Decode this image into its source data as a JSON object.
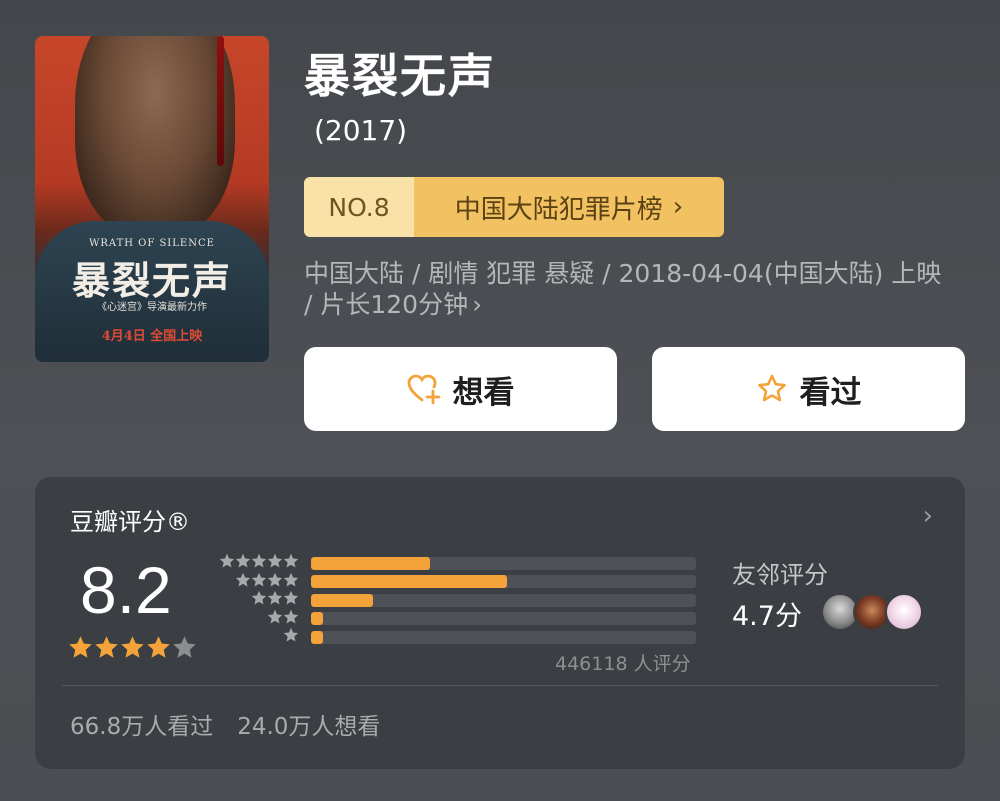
{
  "poster": {
    "en_title": "WRATH OF SILENCE",
    "cn_title": "暴裂无声",
    "tagline": "《心迷宫》导演最新力作",
    "release_note": "4月4日 全国上映"
  },
  "movie": {
    "title": "暴裂无声",
    "year": "(2017)",
    "meta": "中国大陆 / 剧情 犯罪 悬疑 / 2018-04-04(中国大陆) 上映 / 片长120分钟"
  },
  "rank": {
    "no": "NO.8",
    "list": "中国大陆犯罪片榜"
  },
  "actions": {
    "want_label": "想看",
    "seen_label": "看过"
  },
  "rating": {
    "title": "豆瓣评分®",
    "score": "8.2",
    "star_fill": 4,
    "distribution": [
      {
        "stars": 5,
        "fraction": 0.31
      },
      {
        "stars": 4,
        "fraction": 0.51
      },
      {
        "stars": 3,
        "fraction": 0.16
      },
      {
        "stars": 2,
        "fraction": 0.03
      },
      {
        "stars": 1,
        "fraction": 0.03
      }
    ],
    "votes": "446118 人评分",
    "friends_label": "友邻评分",
    "friends_score": "4.7分"
  },
  "stats": {
    "seen": "66.8万人看过",
    "want": "24.0万人想看"
  },
  "colors": {
    "accent": "#f3a33a",
    "rank_no_bg": "#f9e2a8",
    "rank_list_bg": "#f2c162",
    "card_bg": "#3b3e42"
  }
}
